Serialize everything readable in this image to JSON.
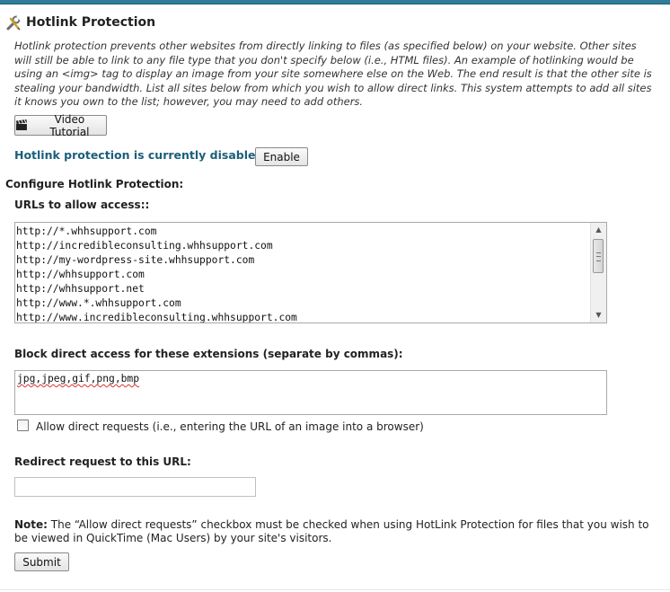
{
  "page": {
    "title": "Hotlink Protection",
    "title_icon": "wrench-pencil-icon",
    "description": "Hotlink protection prevents other websites from directly linking to files (as specified below) on your website. Other sites will still be able to link to any file type that you don't specify below (i.e., HTML files). An example of hotlinking would be using an <img> tag to display an image from your site somewhere else on the Web. The end result is that the other site is stealing your bandwidth. List all sites below from which you wish to allow direct links. This system attempts to add all sites it knows you own to the list; however, you may need to add others."
  },
  "video_tutorial": {
    "label": "Video Tutorial",
    "icon": "clapperboard-icon"
  },
  "status": {
    "text": "Hotlink protection is currently disabled.",
    "enable_label": "Enable"
  },
  "configure_heading": "Configure Hotlink Protection:",
  "urls_section": {
    "label": "URLs to allow access::",
    "urls": [
      "http://*.whhsupport.com",
      "http://incredibleconsulting.whhsupport.com",
      "http://my-wordpress-site.whhsupport.com",
      "http://whhsupport.com",
      "http://whhsupport.net",
      "http://www.*.whhsupport.com",
      "http://www.incredibleconsulting.whhsupport.com"
    ]
  },
  "extensions_section": {
    "label": "Block direct access for these extensions (separate by commas):",
    "value": "jpg,jpeg,gif,png,bmp"
  },
  "allow_direct": {
    "label": "Allow direct requests (i.e., entering the URL of an image into a browser)",
    "checked": false
  },
  "redirect_section": {
    "label": "Redirect request to this URL:",
    "value": ""
  },
  "note": {
    "prefix": "Note:",
    "text": "The “Allow direct requests” checkbox must be checked when using HotLink Protection for files that you wish to be viewed in QuickTime (Mac Users) by your site's visitors."
  },
  "submit_label": "Submit"
}
